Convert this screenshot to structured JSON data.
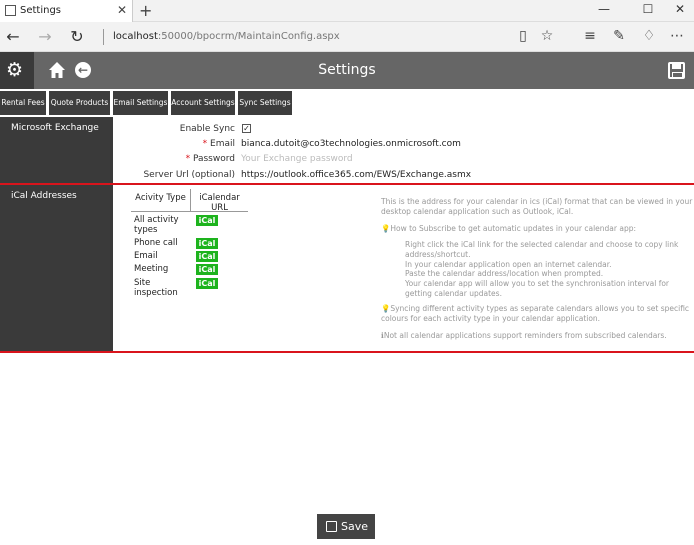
{
  "browser": {
    "tab_title": "Settings",
    "tab_close": "✕",
    "new_tab": "+",
    "url_host": "localhost",
    "url_rest": ":50000/bpocrm/MaintainConfig.aspx",
    "win_min": "—",
    "win_max": "☐",
    "win_close": "✕"
  },
  "header": {
    "title": "Settings"
  },
  "tabs": [
    "Rental Fees",
    "Quote Products",
    "Email Settings",
    "Account Settings",
    "Sync Settings"
  ],
  "exchange": {
    "section_label": "Microsoft Exchange",
    "enable_sync_label": "Enable Sync",
    "email_label": "Email",
    "email_value": "bianca.dutoit@co3technologies.onmicrosoft.com",
    "password_label": "Password",
    "password_placeholder": "Your Exchange password",
    "server_label": "Server Url (optional)",
    "server_value": "https://outlook.office365.com/EWS/Exchange.asmx"
  },
  "ical": {
    "section_label": "iCal Addresses",
    "col_activity": "Acivity Type",
    "col_url": "iCalendar URL",
    "rows": [
      {
        "type": "All activity types",
        "link": "iCal"
      },
      {
        "type": "Phone call",
        "link": "iCal"
      },
      {
        "type": "Email",
        "link": "iCal"
      },
      {
        "type": "Meeting",
        "link": "iCal"
      },
      {
        "type": "Site inspection",
        "link": "iCal"
      }
    ],
    "help": {
      "intro": "This is the address for your calendar in ics (iCal) format that can be viewed in your desktop calendar application such as Outlook, iCal.",
      "howto": "How to Subscribe to get automatic updates in your calendar app:",
      "step1": "Right click the iCal link for the selected calendar and choose to copy link address/shortcut.",
      "step2": "In your calendar application open an internet calendar.",
      "step3": "Paste the calendar address/location when prompted.",
      "step4": "Your calendar app will allow you to set the synchronisation interval for getting calendar updates.",
      "colours": "Syncing different activity types as separate calendars allows you to set specific colours for each activity type in your calendar application.",
      "note": "Not all calendar applications support reminders from subscribed calendars."
    }
  },
  "footer": {
    "save_label": "Save"
  },
  "colors": {
    "accent_red": "#d9141c",
    "ical_green": "#1db31d",
    "dark": "#3a3a3a",
    "header_grey": "#666666"
  }
}
